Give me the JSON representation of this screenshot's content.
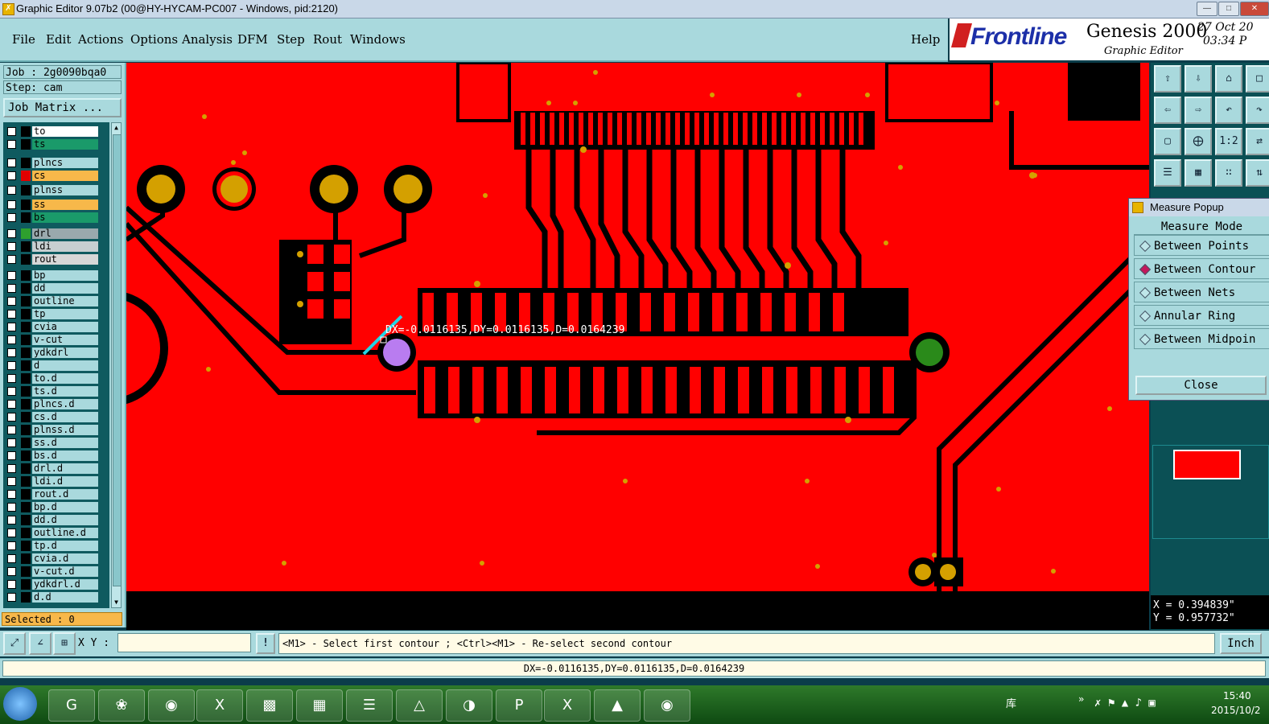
{
  "window": {
    "title": "Graphic Editor 9.07b2 (00@HY-HYCAM-PC007 - Windows, pid:2120)",
    "controls": [
      "—",
      "□",
      "✕"
    ]
  },
  "menu": [
    "File",
    "Edit",
    "Actions",
    "Options",
    "Analysis",
    "DFM",
    "Step",
    "Rout",
    "Windows"
  ],
  "help_label": "Help",
  "brand": {
    "company": "Frontline",
    "product": "Genesis 2000",
    "subtitle": "Graphic Editor",
    "date": "27 Oct 20",
    "time": "03:34 P"
  },
  "job": {
    "job_label": "Job : 2g0090bqa0",
    "step_label": "Step: cam",
    "matrix_button": "Job Matrix ..."
  },
  "layers": [
    {
      "name": "to",
      "color": "#ffffff",
      "swatch": "#000000"
    },
    {
      "name": "ts",
      "color": "#1a9a6a",
      "swatch": "#000000"
    },
    {
      "name": "plncs",
      "color": "#a9d9dd",
      "swatch": "#000000"
    },
    {
      "name": "cs",
      "color": "#f7b84a",
      "swatch": "#e00000"
    },
    {
      "name": "plnss",
      "color": "#a9d9dd",
      "swatch": "#000000"
    },
    {
      "name": "ss",
      "color": "#f7b84a",
      "swatch": "#000000"
    },
    {
      "name": "bs",
      "color": "#1a9a6a",
      "swatch": "#000000"
    },
    {
      "name": "drl",
      "color": "#9aa9ad",
      "swatch": "#2ea02e"
    },
    {
      "name": "ldi",
      "color": "#c7cfd1",
      "swatch": "#000000"
    },
    {
      "name": "rout",
      "color": "#d7d7d7",
      "swatch": "#000000"
    },
    {
      "name": "bp",
      "color": "#a9d9dd",
      "swatch": "#000000"
    },
    {
      "name": "dd",
      "color": "#a9d9dd",
      "swatch": "#000000"
    },
    {
      "name": "outline",
      "color": "#a9d9dd",
      "swatch": "#000000"
    },
    {
      "name": "tp",
      "color": "#a9d9dd",
      "swatch": "#000000"
    },
    {
      "name": "cvia",
      "color": "#a9d9dd",
      "swatch": "#000000"
    },
    {
      "name": "v-cut",
      "color": "#a9d9dd",
      "swatch": "#000000"
    },
    {
      "name": "ydkdrl",
      "color": "#a9d9dd",
      "swatch": "#000000"
    },
    {
      "name": "d",
      "color": "#a9d9dd",
      "swatch": "#000000"
    },
    {
      "name": "to.d",
      "color": "#a9d9dd",
      "swatch": "#000000"
    },
    {
      "name": "ts.d",
      "color": "#a9d9dd",
      "swatch": "#000000"
    },
    {
      "name": "plncs.d",
      "color": "#a9d9dd",
      "swatch": "#000000"
    },
    {
      "name": "cs.d",
      "color": "#a9d9dd",
      "swatch": "#000000"
    },
    {
      "name": "plnss.d",
      "color": "#a9d9dd",
      "swatch": "#000000"
    },
    {
      "name": "ss.d",
      "color": "#a9d9dd",
      "swatch": "#000000"
    },
    {
      "name": "bs.d",
      "color": "#a9d9dd",
      "swatch": "#000000"
    },
    {
      "name": "drl.d",
      "color": "#a9d9dd",
      "swatch": "#000000"
    },
    {
      "name": "ldi.d",
      "color": "#a9d9dd",
      "swatch": "#000000"
    },
    {
      "name": "rout.d",
      "color": "#a9d9dd",
      "swatch": "#000000"
    },
    {
      "name": "bp.d",
      "color": "#a9d9dd",
      "swatch": "#000000"
    },
    {
      "name": "dd.d",
      "color": "#a9d9dd",
      "swatch": "#000000"
    },
    {
      "name": "outline.d",
      "color": "#a9d9dd",
      "swatch": "#000000"
    },
    {
      "name": "tp.d",
      "color": "#a9d9dd",
      "swatch": "#000000"
    },
    {
      "name": "cvia.d",
      "color": "#a9d9dd",
      "swatch": "#000000"
    },
    {
      "name": "v-cut.d",
      "color": "#a9d9dd",
      "swatch": "#000000"
    },
    {
      "name": "ydkdrl.d",
      "color": "#a9d9dd",
      "swatch": "#000000"
    },
    {
      "name": "d.d",
      "color": "#a9d9dd",
      "swatch": "#000000"
    }
  ],
  "selected_label": "Selected : 0",
  "canvas": {
    "measure_annotation": "DX=-0.0116135,DY=0.0116135,D=0.0164239"
  },
  "measure_popup": {
    "title": "Measure Popup",
    "mode_label": "Measure Mode",
    "options": [
      "Between Points",
      "Between Contour",
      "Between Nets",
      "Annular Ring",
      "Between Midpoin"
    ],
    "selected_option": "Between Contour",
    "close_label": "Close"
  },
  "coords": {
    "x": "X = 0.394839\"",
    "y": "Y = 0.957732\""
  },
  "command": {
    "xy_label": "X Y :",
    "xy_value": "",
    "prompt": "<M1> - Select first contour ; <Ctrl><M1> - Re-select second contour",
    "units": "Inch"
  },
  "status": "DX=-0.0116135,DY=0.0116135,D=0.0164239",
  "taskbar": {
    "tray_label": "库",
    "clock_time": "15:40",
    "clock_date": "2015/10/2"
  },
  "colors": {
    "panel": "#a9d9dd",
    "canvas_bg": "#ff0000",
    "copper": "#000000",
    "pad": "#d4a000",
    "accent": "#1c2fa8"
  }
}
